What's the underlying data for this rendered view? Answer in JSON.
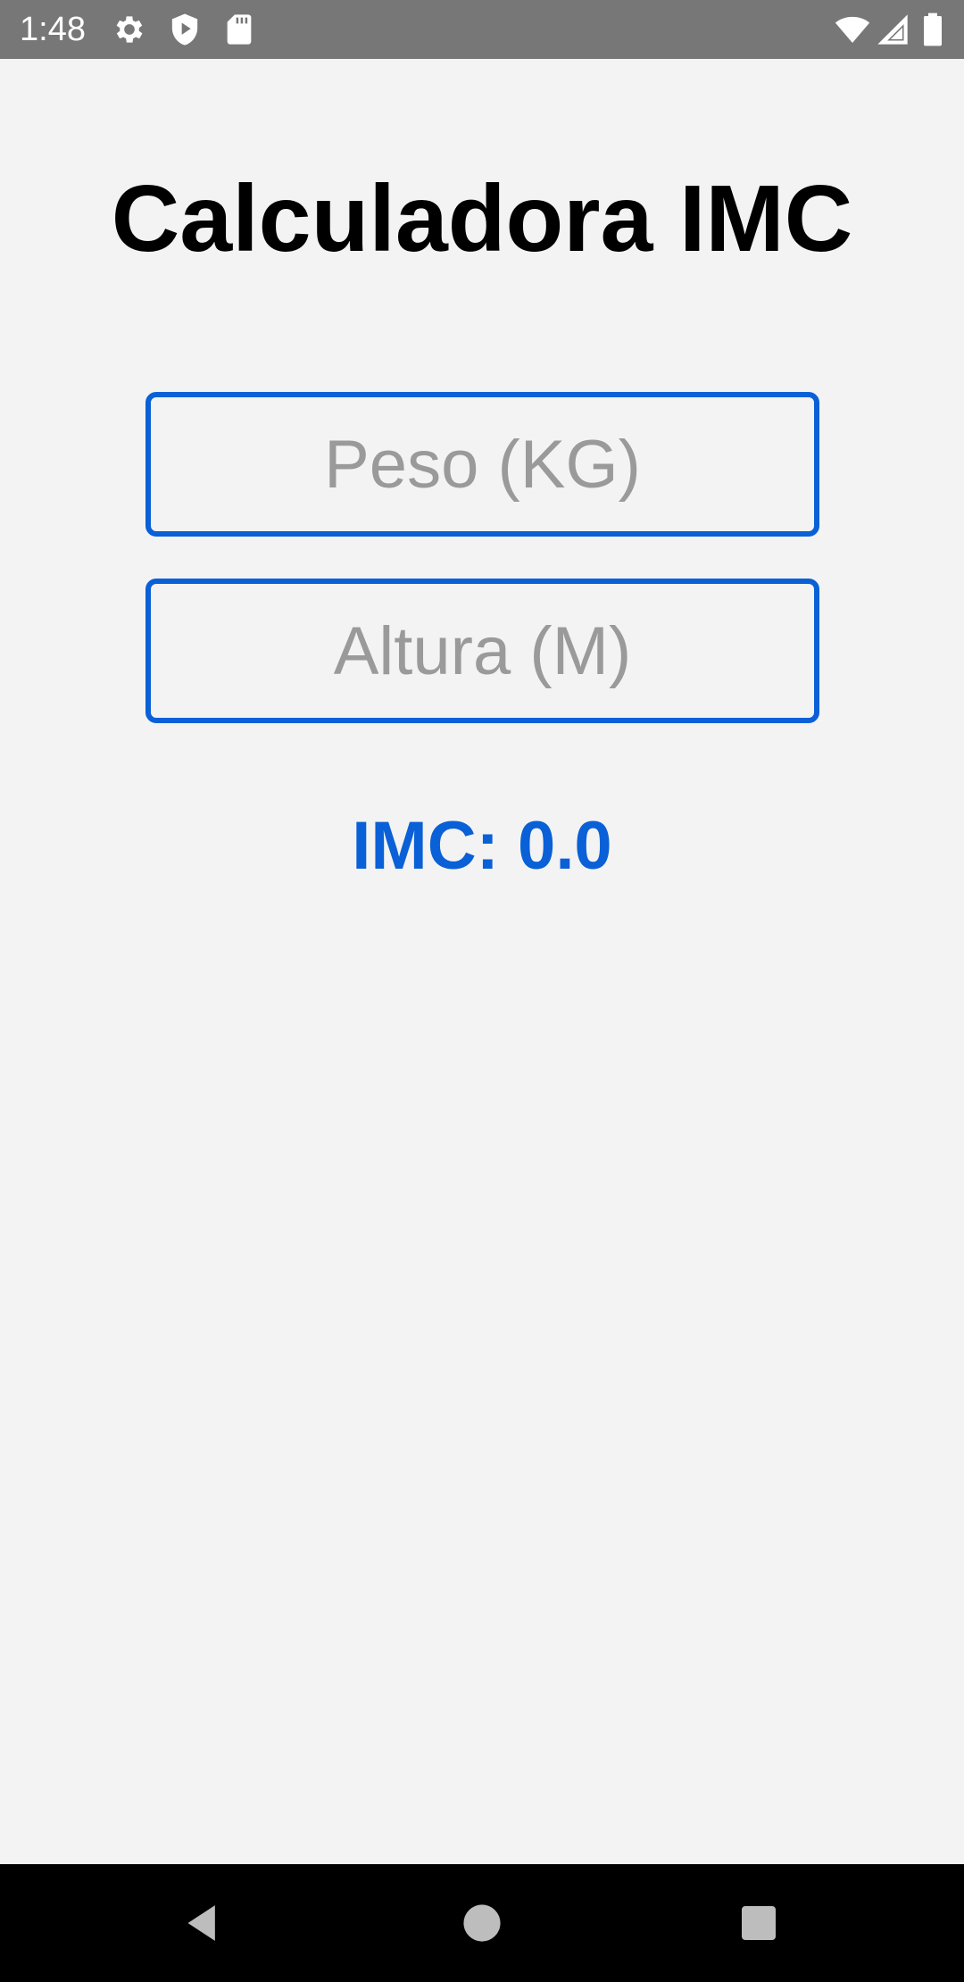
{
  "status_bar": {
    "time": "1:48",
    "icons_left": [
      "gear-icon",
      "shield-play-icon",
      "sd-card-icon"
    ],
    "icons_right": [
      "wifi-icon",
      "signal-icon",
      "battery-icon"
    ]
  },
  "app": {
    "title": "Calculadora IMC",
    "peso_placeholder": "Peso (KG)",
    "altura_placeholder": "Altura (M)",
    "result_label": "IMC:",
    "result_value": "0.0"
  },
  "nav_bar": {
    "buttons": [
      "back-icon",
      "home-icon",
      "recents-icon"
    ]
  },
  "colors": {
    "accent": "#0a60d6",
    "background": "#f3f3f3",
    "status_bar": "#777777",
    "nav_bar": "#000000",
    "placeholder": "#9a9a9a"
  }
}
